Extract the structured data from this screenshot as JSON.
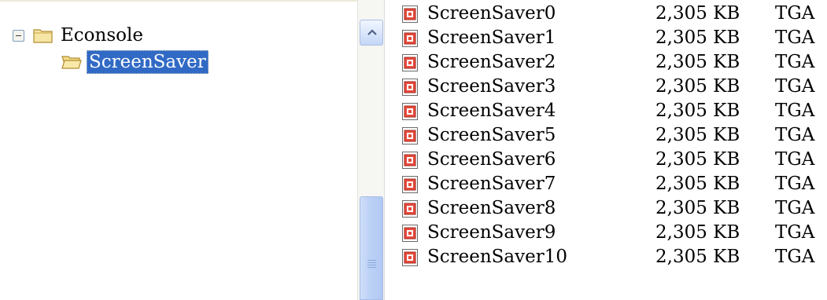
{
  "tree": {
    "root": {
      "label": "Econsole",
      "expanded": true,
      "icon": "folder-closed-icon"
    },
    "child": {
      "label": "ScreenSaver",
      "selected": true,
      "icon": "folder-open-icon"
    },
    "selection_color": "#316ac5"
  },
  "scrollbar": {
    "up_arrow_icon": "chevron-up-icon",
    "thumb_color": "#bcd1f6"
  },
  "files": [
    {
      "name": "ScreenSaver0",
      "size": "2,305 KB",
      "type": "TGA",
      "icon": "tga-image-file-icon"
    },
    {
      "name": "ScreenSaver1",
      "size": "2,305 KB",
      "type": "TGA",
      "icon": "tga-image-file-icon"
    },
    {
      "name": "ScreenSaver2",
      "size": "2,305 KB",
      "type": "TGA",
      "icon": "tga-image-file-icon"
    },
    {
      "name": "ScreenSaver3",
      "size": "2,305 KB",
      "type": "TGA",
      "icon": "tga-image-file-icon"
    },
    {
      "name": "ScreenSaver4",
      "size": "2,305 KB",
      "type": "TGA",
      "icon": "tga-image-file-icon"
    },
    {
      "name": "ScreenSaver5",
      "size": "2,305 KB",
      "type": "TGA",
      "icon": "tga-image-file-icon"
    },
    {
      "name": "ScreenSaver6",
      "size": "2,305 KB",
      "type": "TGA",
      "icon": "tga-image-file-icon"
    },
    {
      "name": "ScreenSaver7",
      "size": "2,305 KB",
      "type": "TGA",
      "icon": "tga-image-file-icon"
    },
    {
      "name": "ScreenSaver8",
      "size": "2,305 KB",
      "type": "TGA",
      "icon": "tga-image-file-icon"
    },
    {
      "name": "ScreenSaver9",
      "size": "2,305 KB",
      "type": "TGA",
      "icon": "tga-image-file-icon"
    },
    {
      "name": "ScreenSaver10",
      "size": "2,305 KB",
      "type": "TGA",
      "icon": "tga-image-file-icon"
    }
  ]
}
